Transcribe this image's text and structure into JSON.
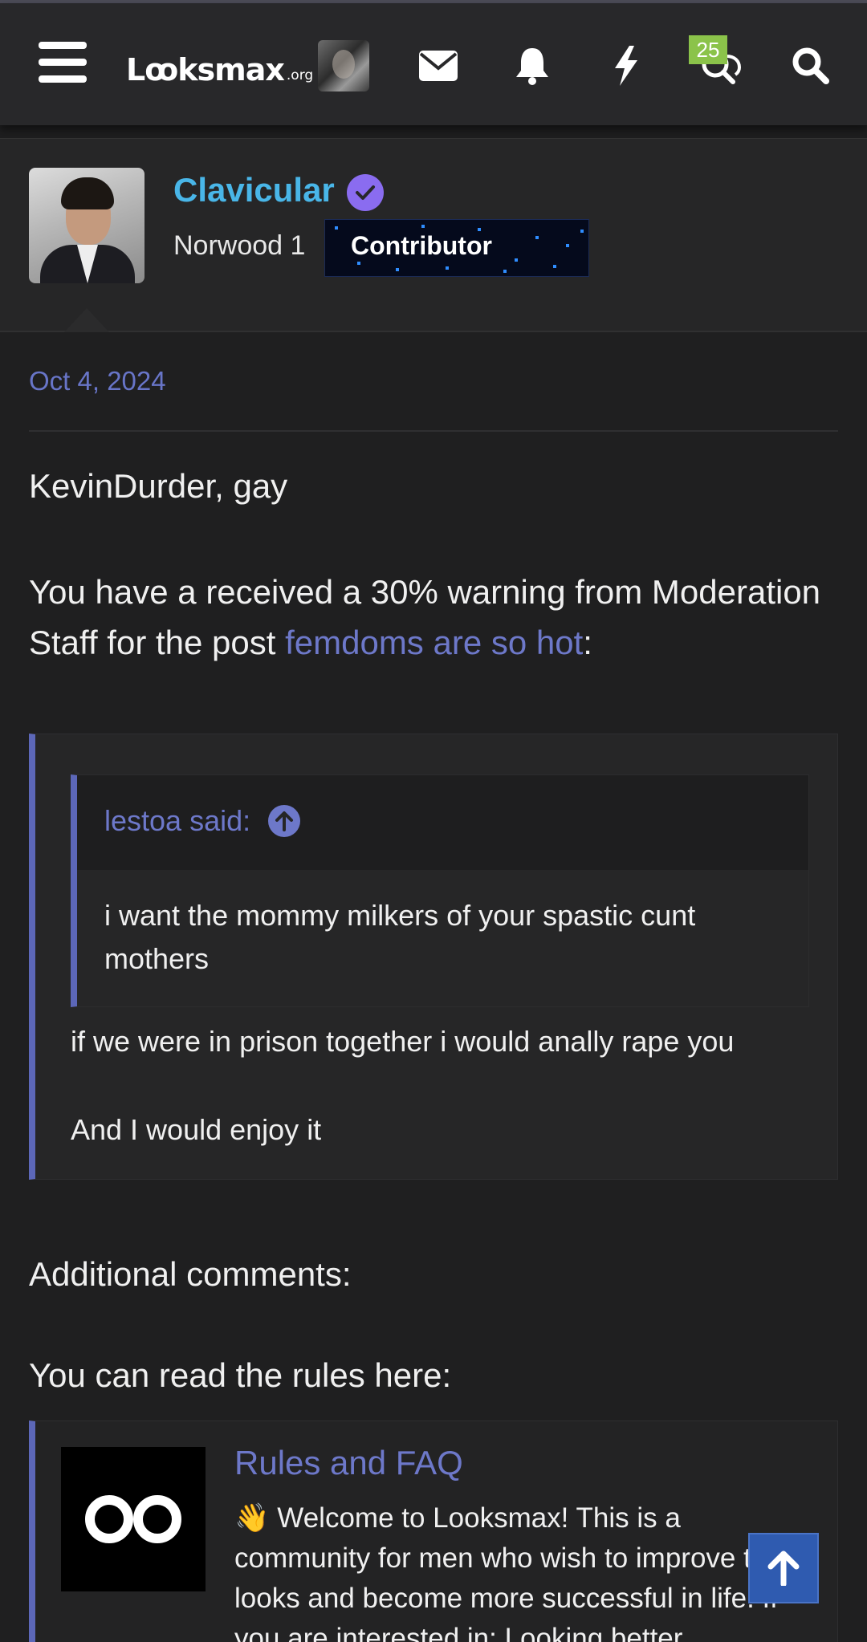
{
  "header": {
    "logo_main": "Lꝏksmax",
    "logo_suffix": ".org",
    "alerts_badge": "25",
    "icons": [
      "menu-icon",
      "envelope-icon",
      "bell-icon",
      "lightning-icon",
      "chat-search-icon",
      "search-icon"
    ]
  },
  "author": {
    "name": "Clavicular",
    "title": "Norwood 1",
    "banner": "Contributor"
  },
  "post": {
    "date": "Oct 4, 2024",
    "line1": "KevinDurder, gay",
    "warning_prefix": "You have a received a 30% warning from Moderation Staff for the post ",
    "warning_link": "femdoms are so hot",
    "warning_suffix": ":",
    "quote": {
      "nested_author": "lestoa said:",
      "nested_text": "i want the mommy milkers of your spastic cunt mothers",
      "line1": "if we were in prison together i would anally rape you",
      "line2": "And I would enjoy it"
    },
    "additional_comments": "Additional comments:",
    "rules_text": "You can read the rules here:",
    "embed": {
      "title": "Rules and FAQ",
      "text": "👋 Welcome to Looksmax! This is a community for men who wish to improve their looks and become more successful in life. If you are interested in: Looking better"
    }
  },
  "colors": {
    "accent_link": "#6d78c9",
    "author_name": "#49b6e8",
    "verified": "#8a6cf0",
    "badge": "#8bc34a",
    "scroll_top": "#2f5bb0"
  }
}
